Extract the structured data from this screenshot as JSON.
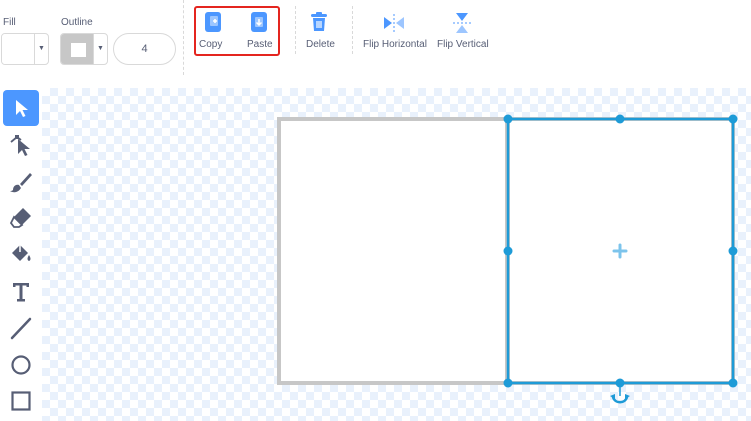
{
  "toolbar": {
    "fill_label": "Fill",
    "outline_label": "Outline",
    "outline_width": "4",
    "copy_label": "Copy",
    "paste_label": "Paste",
    "delete_label": "Delete",
    "flip_horizontal_label": "Flip Horizontal",
    "flip_vertical_label": "Flip Vertical"
  },
  "tools": [
    {
      "name": "select",
      "icon": "arrow-pointer-icon",
      "selected": true
    },
    {
      "name": "reshape",
      "icon": "reshape-pointer-icon",
      "selected": false
    },
    {
      "name": "brush",
      "icon": "brush-icon",
      "selected": false
    },
    {
      "name": "eraser",
      "icon": "eraser-icon",
      "selected": false
    },
    {
      "name": "fill",
      "icon": "paint-bucket-icon",
      "selected": false
    },
    {
      "name": "text",
      "icon": "text-t-icon",
      "selected": false
    },
    {
      "name": "line",
      "icon": "line-icon",
      "selected": false
    },
    {
      "name": "circle",
      "icon": "circle-icon",
      "selected": false
    },
    {
      "name": "rectangle",
      "icon": "rectangle-icon",
      "selected": false
    }
  ],
  "colors": {
    "accent": "#4c97ff",
    "selection": "#1e9bd7",
    "highlight_box": "#e4251f",
    "outline_swatch": "#c7c7c7",
    "icon": "#575e75"
  }
}
